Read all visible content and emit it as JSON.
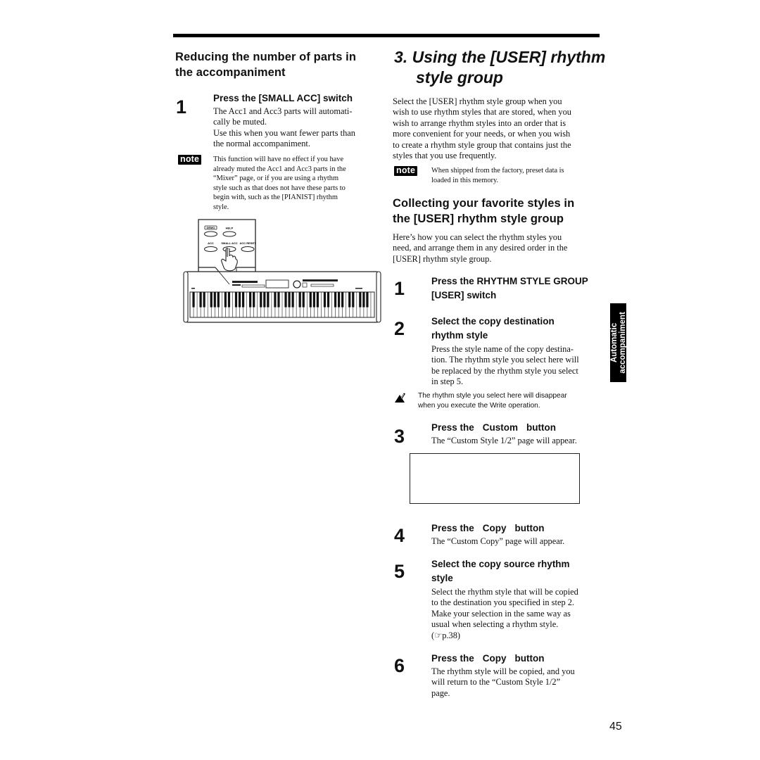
{
  "page_number": "45",
  "side_tab": {
    "line1": "Automatic",
    "line2": "accompaniment"
  },
  "left_section": {
    "heading_line1": "Reducing the number of parts in",
    "heading_line2": "the accompaniment",
    "step1": {
      "number": "1",
      "title": "Press the [SMALL ACC] switch",
      "lines": [
        "The Acc1 and Acc3 parts will automati-",
        "cally be muted.",
        "Use this when you want fewer parts than",
        "the normal accompaniment."
      ]
    },
    "note": {
      "badge": "note",
      "lines": [
        "This function will have no effect if you have",
        "already muted the Acc1 and Acc3 parts in the",
        "“Mixer” page, or if you are using a rhythm",
        "style such as that does not have these parts to",
        "begin with, such as the [PIANIST] rhythm",
        "style."
      ]
    },
    "illustration": {
      "panel_labels": [
        "DEMO",
        "HELP",
        "ACC",
        "SMALL ACC",
        "ACC RESET"
      ]
    }
  },
  "right_section": {
    "title_line1": "3. Using the [USER] rhythm",
    "title_line2": "style group",
    "intro_lines": [
      "Select the [USER] rhythm style group when you",
      "wish to use rhythm styles that are stored, when you",
      "wish to arrange rhythm styles into an order that is",
      "more convenient for your needs, or when you wish",
      "to create a rhythm style group that contains just the",
      "styles that you use frequently."
    ],
    "note": {
      "badge": "note",
      "lines": [
        "When shipped from the factory, preset data is",
        "loaded in this memory."
      ]
    },
    "subheading_line1": "Collecting your favorite styles in",
    "subheading_line2": "the [USER] rhythm style group",
    "sub_intro_lines": [
      "Here’s how you can select the rhythm styles you",
      "need, and arrange them in any desired order in the",
      "[USER] rhythm style group."
    ],
    "steps": [
      {
        "number": "1",
        "title_lines": [
          "Press the RHYTHM STYLE GROUP",
          "[USER] switch"
        ],
        "body_lines": []
      },
      {
        "number": "2",
        "title_lines": [
          "Select the copy destination",
          "rhythm style"
        ],
        "body_lines": [
          "Press the style name of the copy destina-",
          "tion. The rhythm style you select here will",
          "be replaced by the rhythm style you select",
          "in step 5."
        ]
      },
      {
        "number": "3",
        "title_prefix": "Press the",
        "title_button": "Custom",
        "title_suffix": "button",
        "body_lines": [
          "The “Custom Style 1/2” page will appear."
        ]
      },
      {
        "number": "4",
        "title_prefix": "Press the",
        "title_button": "Copy",
        "title_suffix": "button",
        "body_lines": [
          "The “Custom Copy” page will appear."
        ]
      },
      {
        "number": "5",
        "title_lines": [
          "Select the copy source rhythm",
          "style"
        ],
        "body_lines": [
          "Select the rhythm style that will be copied",
          "to the destination you specified in step 2.",
          "Make your selection in the same way as",
          "usual when selecting a rhythm style.",
          "(☞p.38)"
        ]
      },
      {
        "number": "6",
        "title_prefix": "Press the",
        "title_button": "Copy",
        "title_suffix": "button",
        "body_lines": [
          "The rhythm style will be copied, and you",
          "will return to the “Custom Style 1/2”",
          "page."
        ]
      }
    ],
    "caution": {
      "icon": "caution-hand-icon",
      "lines": [
        "The rhythm style you select here will disappear",
        "when you execute the Write operation."
      ]
    }
  }
}
